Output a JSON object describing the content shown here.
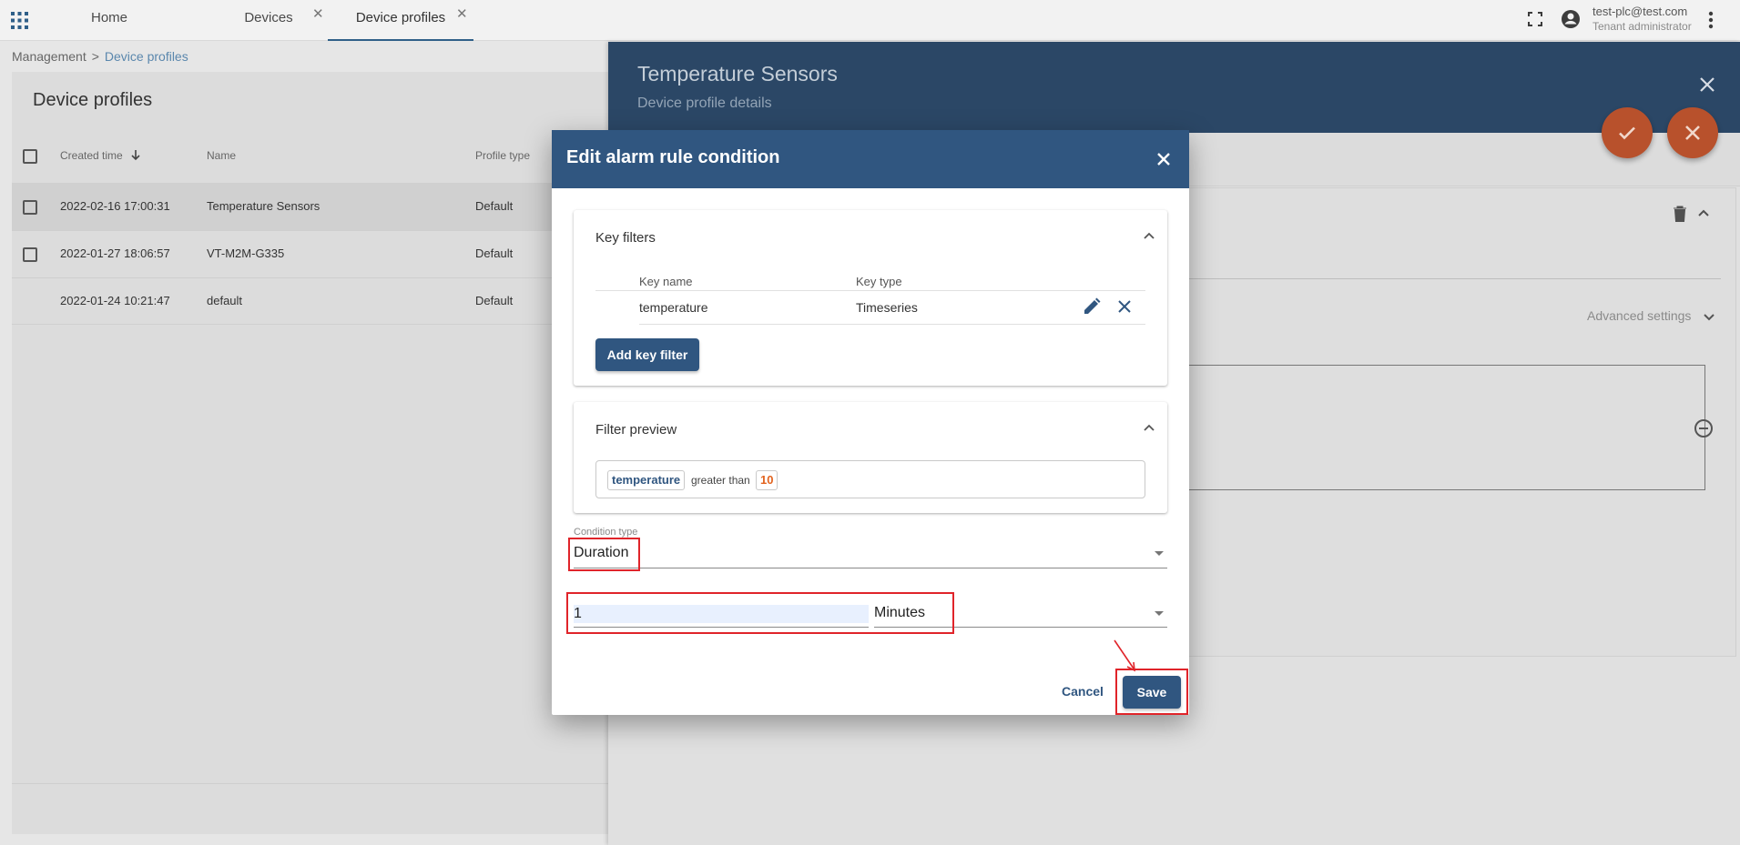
{
  "topbar": {
    "tabs": [
      {
        "label": "Home"
      },
      {
        "label": "Devices",
        "close": "✕"
      },
      {
        "label": "Device profiles",
        "close": "✕"
      }
    ],
    "user_email": "test-plc@test.com",
    "user_role": "Tenant administrator"
  },
  "breadcrumb": {
    "parent": "Management",
    "separator": ">",
    "current": "Device profiles"
  },
  "profiles": {
    "title": "Device profiles",
    "columns": [
      "Created time",
      "Name",
      "Profile type"
    ],
    "rows": [
      {
        "created": "2022-02-16 17:00:31",
        "name": "Temperature Sensors",
        "type": "Default"
      },
      {
        "created": "2022-01-27 18:06:57",
        "name": "VT-M2M-G335",
        "type": "Default"
      },
      {
        "created": "2022-01-24 10:21:47",
        "name": "default",
        "type": "Default"
      }
    ]
  },
  "details": {
    "title": "Temperature Sensors",
    "subtitle": "Device profile details",
    "advanced_settings": "Advanced settings"
  },
  "dialog": {
    "title": "Edit alarm rule condition",
    "key_filters": {
      "title": "Key filters",
      "col_key_name": "Key name",
      "col_key_type": "Key type",
      "rows": [
        {
          "key_name": "temperature",
          "key_type": "Timeseries"
        }
      ],
      "add_button": "Add key filter"
    },
    "filter_preview": {
      "title": "Filter preview",
      "key": "temperature",
      "operation": "greater than",
      "value": "10"
    },
    "condition_type": {
      "label": "Condition type",
      "value": "Duration"
    },
    "duration": {
      "value": "1",
      "unit": "Minutes"
    },
    "cancel": "Cancel",
    "save": "Save"
  },
  "watermark": {
    "line1": "",
    "line2": ""
  },
  "colors": {
    "header_blue": "#305680",
    "details_header": "#2b4766",
    "fab_orange": "#b8512c",
    "highlight_red": "#e0242a",
    "value_orange": "#e2631f"
  }
}
